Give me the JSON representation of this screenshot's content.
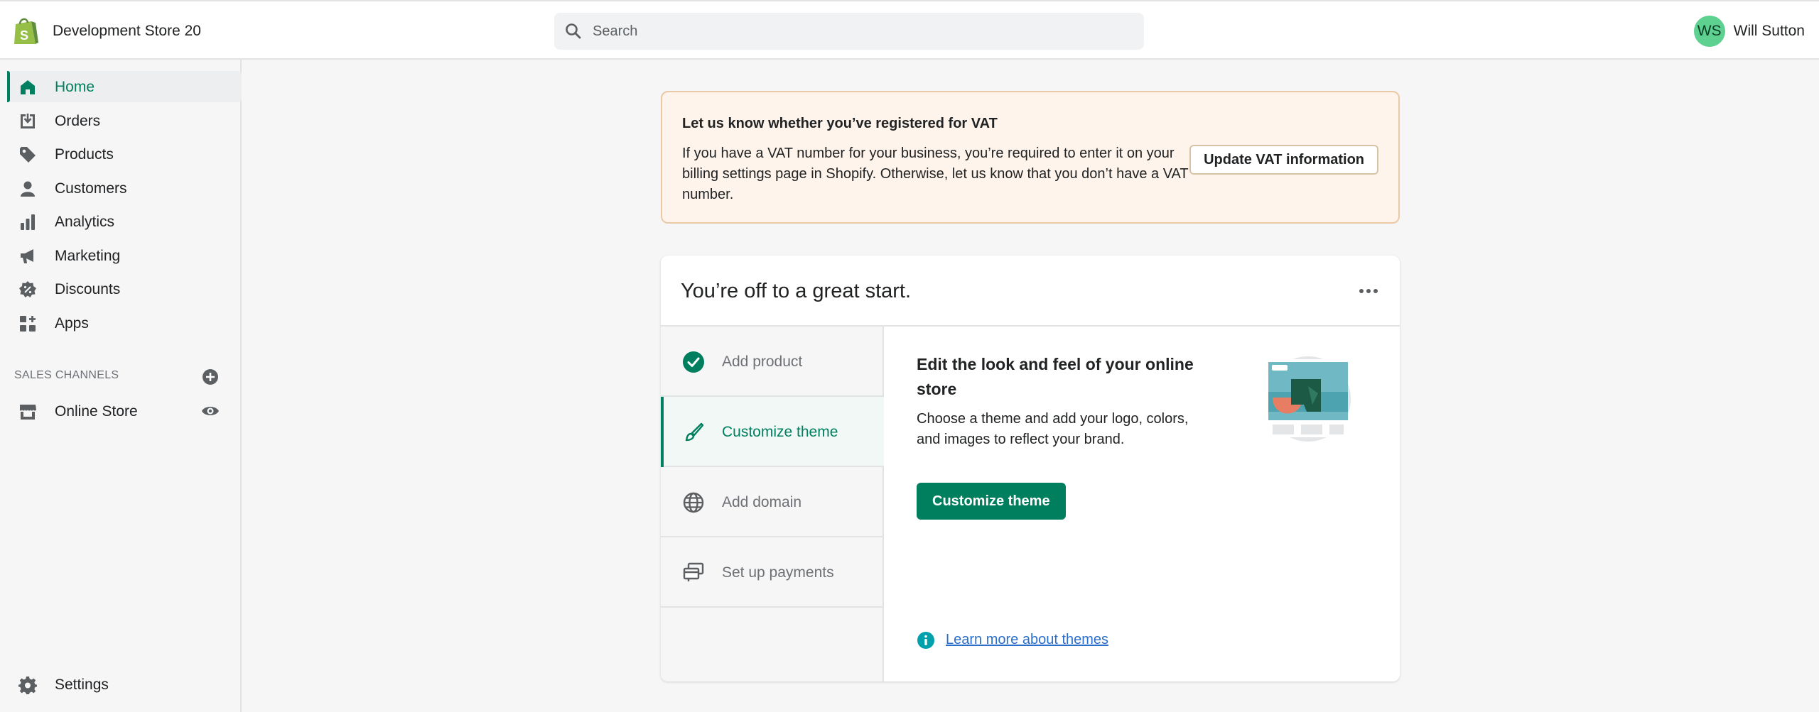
{
  "header": {
    "store_name": "Development Store 20",
    "search_placeholder": "Search",
    "user_initials": "WS",
    "user_name": "Will Sutton"
  },
  "sidebar": {
    "items": [
      {
        "label": "Home",
        "icon": "home-icon",
        "active": true
      },
      {
        "label": "Orders",
        "icon": "orders-icon"
      },
      {
        "label": "Products",
        "icon": "tag-icon"
      },
      {
        "label": "Customers",
        "icon": "person-icon"
      },
      {
        "label": "Analytics",
        "icon": "bar-chart-icon"
      },
      {
        "label": "Marketing",
        "icon": "megaphone-icon"
      },
      {
        "label": "Discounts",
        "icon": "discount-icon"
      },
      {
        "label": "Apps",
        "icon": "apps-icon"
      }
    ],
    "sales_channels_title": "SALES CHANNELS",
    "online_store_label": "Online Store",
    "settings_label": "Settings"
  },
  "vat_banner": {
    "title": "Let us know whether you’ve registered for VAT",
    "body": "If you have a VAT number for your business, you’re required to enter it on your billing settings page in Shopify. Otherwise, let us know that you don’t have a VAT number.",
    "button_label": "Update VAT information"
  },
  "setup_card": {
    "title": "You’re off to a great start.",
    "steps": [
      {
        "label": "Add product",
        "icon": "check-circle-icon",
        "done": true
      },
      {
        "label": "Customize theme",
        "icon": "brush-icon",
        "active": true
      },
      {
        "label": "Add domain",
        "icon": "globe-icon"
      },
      {
        "label": "Set up payments",
        "icon": "payments-icon"
      }
    ],
    "detail_title": "Edit the look and feel of your online store",
    "detail_description": "Choose a theme and add your logo, colors, and images to reflect your brand.",
    "primary_button": "Customize theme",
    "learn_more_link": "Learn more about themes"
  },
  "colors": {
    "accent": "#008060",
    "banner_bg": "#fff4eb",
    "link": "#2c6ecb"
  }
}
